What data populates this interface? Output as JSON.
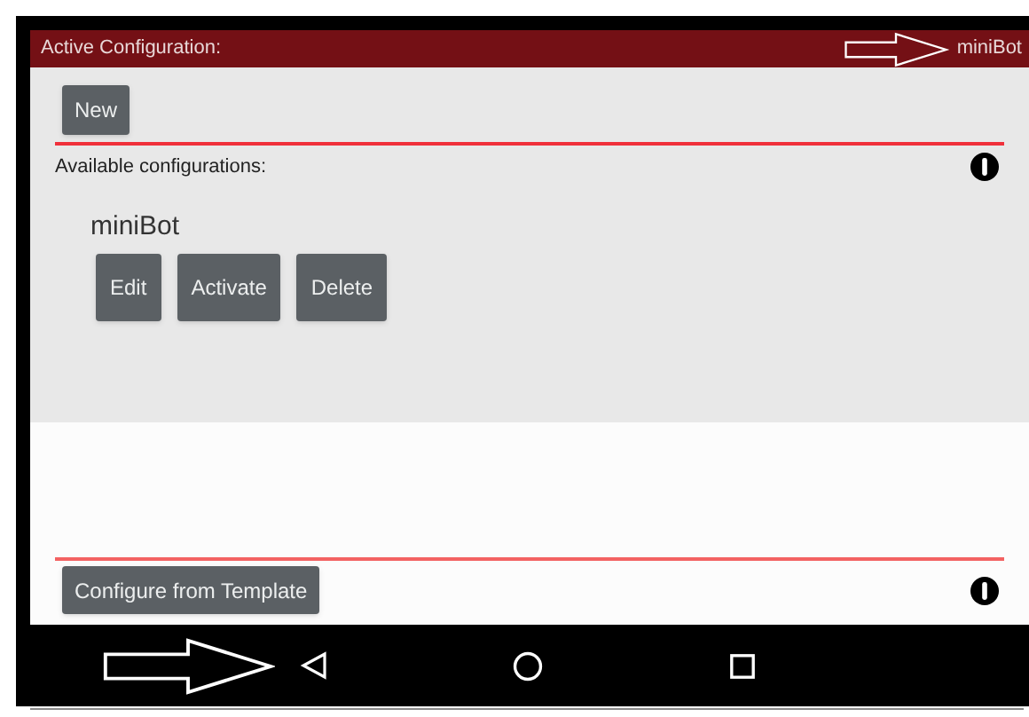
{
  "header": {
    "title": "Active Configuration:",
    "active_name": "miniBot"
  },
  "new_button": "New",
  "available": {
    "label": "Available configurations:",
    "configs": [
      {
        "name": "miniBot",
        "actions": [
          "Edit",
          "Activate",
          "Delete"
        ]
      }
    ]
  },
  "template_button": "Configure from Template"
}
